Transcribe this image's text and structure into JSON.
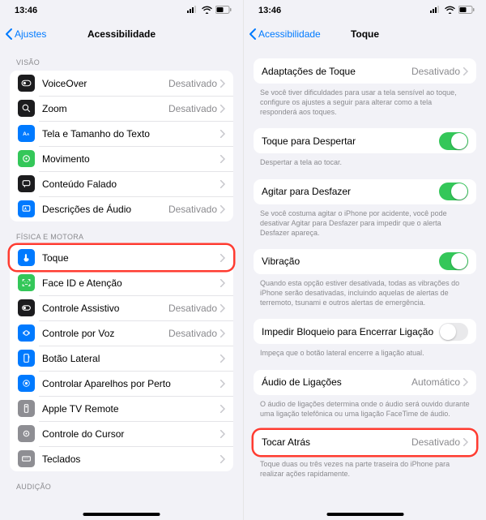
{
  "status": {
    "time": "13:46"
  },
  "left": {
    "back": "Ajustes",
    "title": "Acessibilidade",
    "sections": {
      "vision": "VISÃO",
      "motor": "FÍSICA E MOTORA",
      "hearing": "AUDIÇÃO"
    },
    "rows": {
      "voiceover": {
        "label": "VoiceOver",
        "value": "Desativado"
      },
      "zoom": {
        "label": "Zoom",
        "value": "Desativado"
      },
      "display": {
        "label": "Tela e Tamanho do Texto"
      },
      "motion": {
        "label": "Movimento"
      },
      "spoken": {
        "label": "Conteúdo Falado"
      },
      "audiodesc": {
        "label": "Descrições de Áudio",
        "value": "Desativado"
      },
      "touch": {
        "label": "Toque"
      },
      "faceid": {
        "label": "Face ID e Atenção"
      },
      "switch": {
        "label": "Controle Assistivo",
        "value": "Desativado"
      },
      "voice": {
        "label": "Controle por Voz",
        "value": "Desativado"
      },
      "sidebtn": {
        "label": "Botão Lateral"
      },
      "nearby": {
        "label": "Controlar Aparelhos por Perto"
      },
      "appletv": {
        "label": "Apple TV Remote"
      },
      "pointer": {
        "label": "Controle do Cursor"
      },
      "keyboards": {
        "label": "Teclados"
      }
    }
  },
  "right": {
    "back": "Acessibilidade",
    "title": "Toque",
    "rows": {
      "accom": {
        "label": "Adaptações de Toque",
        "value": "Desativado"
      },
      "tapwake": {
        "label": "Toque para Despertar"
      },
      "shake": {
        "label": "Agitar para Desfazer"
      },
      "vibration": {
        "label": "Vibração"
      },
      "lockend": {
        "label": "Impedir Bloqueio para Encerrar Ligação"
      },
      "callaudio": {
        "label": "Áudio de Ligações",
        "value": "Automático"
      },
      "backtap": {
        "label": "Tocar Atrás",
        "value": "Desativado"
      }
    },
    "foot": {
      "accom": "Se você tiver dificuldades para usar a tela sensível ao toque, configure os ajustes a seguir para alterar como a tela responderá aos toques.",
      "tapwake": "Despertar a tela ao tocar.",
      "shake": "Se você costuma agitar o iPhone por acidente, você pode desativar Agitar para Desfazer para impedir que o alerta Desfazer apareça.",
      "vibration": "Quando esta opção estiver desativada, todas as vibrações do iPhone serão desativadas, incluindo aquelas de alertas de terremoto, tsunami e outros alertas de emergência.",
      "lockend": "Impeça que o botão lateral encerre a ligação atual.",
      "callaudio": "O áudio de ligações determina onde o áudio será ouvido durante uma ligação telefônica ou uma ligação FaceTime de áudio.",
      "backtap": "Toque duas ou três vezes na parte traseira do iPhone para realizar ações rapidamente."
    }
  }
}
